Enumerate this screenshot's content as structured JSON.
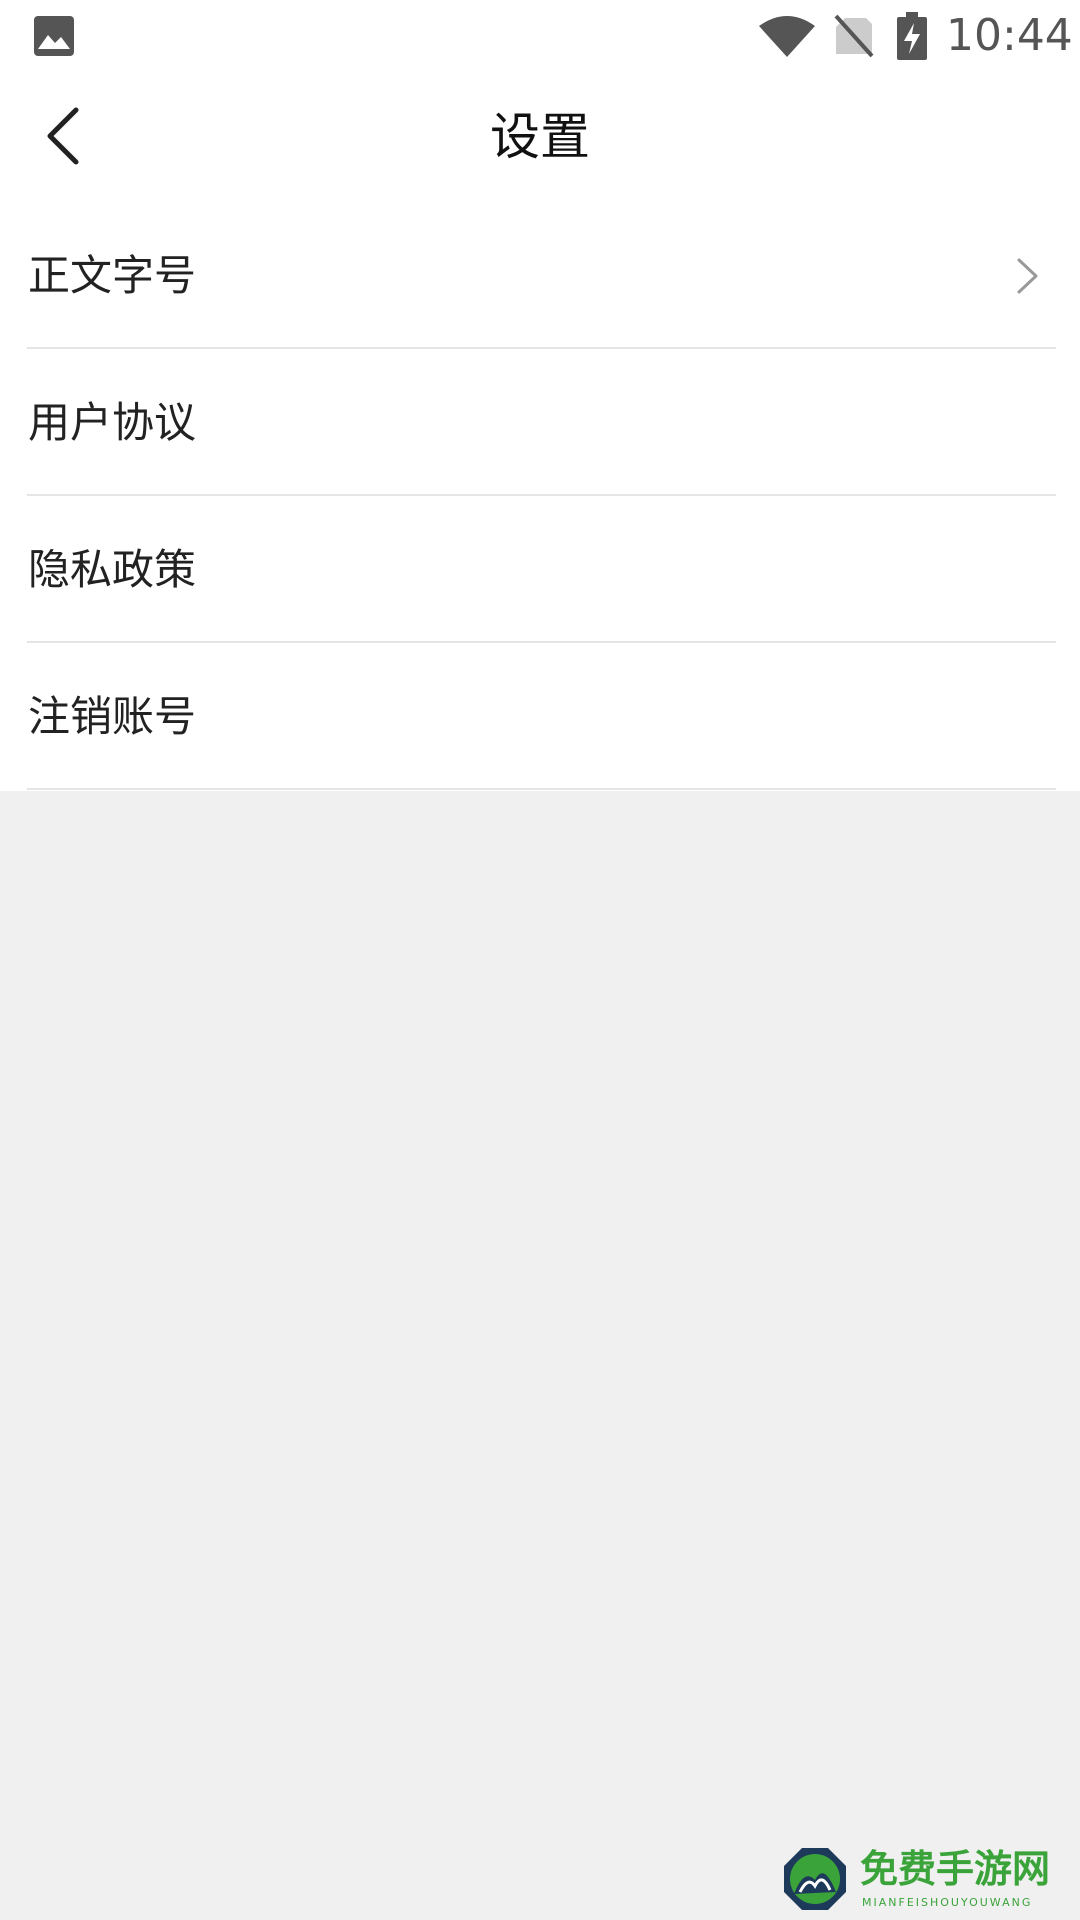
{
  "status_bar": {
    "time": "10:44",
    "icons": [
      "gallery-icon",
      "wifi-icon",
      "no-sim-icon",
      "battery-charging-icon"
    ]
  },
  "header": {
    "title": "设置",
    "back_icon": "chevron-left-icon"
  },
  "settings": {
    "items": [
      {
        "label": "正文字号",
        "has_chevron": true
      },
      {
        "label": "用户协议",
        "has_chevron": false
      },
      {
        "label": "隐私政策",
        "has_chevron": false
      },
      {
        "label": "注销账号",
        "has_chevron": false
      }
    ]
  },
  "watermark": {
    "title": "免费手游网",
    "subtitle": "MIANFEISHOUYOUWANG"
  },
  "colors": {
    "page_background": "#f0f0f0",
    "content_background": "#ffffff",
    "divider": "#e5e5e5",
    "text": "#222222",
    "status_icons": "#555555",
    "watermark_green": "#3aa43a",
    "watermark_navy": "#1e3a5a"
  }
}
